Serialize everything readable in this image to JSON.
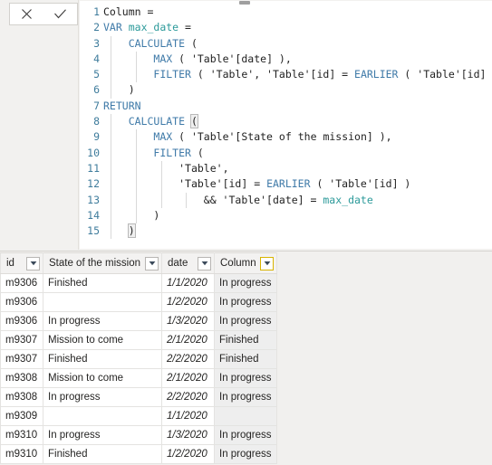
{
  "editor": {
    "commit": {
      "cancel_label": "✕",
      "cancel_name": "cancel-formula",
      "accept_label": "✓",
      "accept_name": "accept-formula"
    },
    "language": "DAX",
    "line_numbers": [
      "1",
      "2",
      "3",
      "4",
      "5",
      "6",
      "7",
      "8",
      "9",
      "10",
      "11",
      "12",
      "13",
      "14",
      "15"
    ],
    "lines": [
      "Column =",
      "VAR max_date =",
      "    CALCULATE (",
      "        MAX ( 'Table'[date] ),",
      "        FILTER ( 'Table', 'Table'[id] = EARLIER ( 'Table'[id] ) )",
      "    )",
      "RETURN",
      "    CALCULATE (",
      "        MAX ( 'Table'[State of the mission] ),",
      "        FILTER (",
      "            'Table',",
      "            'Table'[id] = EARLIER ( 'Table'[id] )",
      "                && 'Table'[date] = max_date",
      "        )",
      "    )"
    ],
    "tokens": {
      "keywords": [
        "VAR",
        "RETURN"
      ],
      "functions": [
        "CALCULATE",
        "MAX",
        "FILTER",
        "EARLIER"
      ],
      "variables": [
        "max_date"
      ],
      "colors": {
        "keyword": "#3f7aa8",
        "function": "#3f7aa8",
        "variable": "#2c9a9a",
        "plain": "#222222",
        "line_number": "#3f7c9c"
      }
    }
  },
  "table": {
    "columns": [
      {
        "label": "id",
        "key": "id",
        "highlight": false
      },
      {
        "label": "State of the mission",
        "key": "state",
        "highlight": false
      },
      {
        "label": "date",
        "key": "date",
        "highlight": false
      },
      {
        "label": "Column",
        "key": "column",
        "highlight": true
      }
    ],
    "filter_icon": "chevron-down-icon",
    "highlight_color": "#f2c811",
    "rows": [
      {
        "id": "m9306",
        "state": "Finished",
        "date": "1/1/2020",
        "column": "In progress"
      },
      {
        "id": "m9306",
        "state": "",
        "date": "1/2/2020",
        "column": "In progress"
      },
      {
        "id": "m9306",
        "state": "In progress",
        "date": "1/3/2020",
        "column": "In progress"
      },
      {
        "id": "m9307",
        "state": "Mission to come",
        "date": "2/1/2020",
        "column": "Finished"
      },
      {
        "id": "m9307",
        "state": "Finished",
        "date": "2/2/2020",
        "column": "Finished"
      },
      {
        "id": "m9308",
        "state": "Mission to come",
        "date": "2/1/2020",
        "column": "In progress"
      },
      {
        "id": "m9308",
        "state": "In progress",
        "date": "2/2/2020",
        "column": "In progress"
      },
      {
        "id": "m9309",
        "state": "",
        "date": "1/1/2020",
        "column": ""
      },
      {
        "id": "m9310",
        "state": "In progress",
        "date": "1/3/2020",
        "column": "In progress"
      },
      {
        "id": "m9310",
        "state": "Finished",
        "date": "1/2/2020",
        "column": "In progress"
      }
    ]
  }
}
